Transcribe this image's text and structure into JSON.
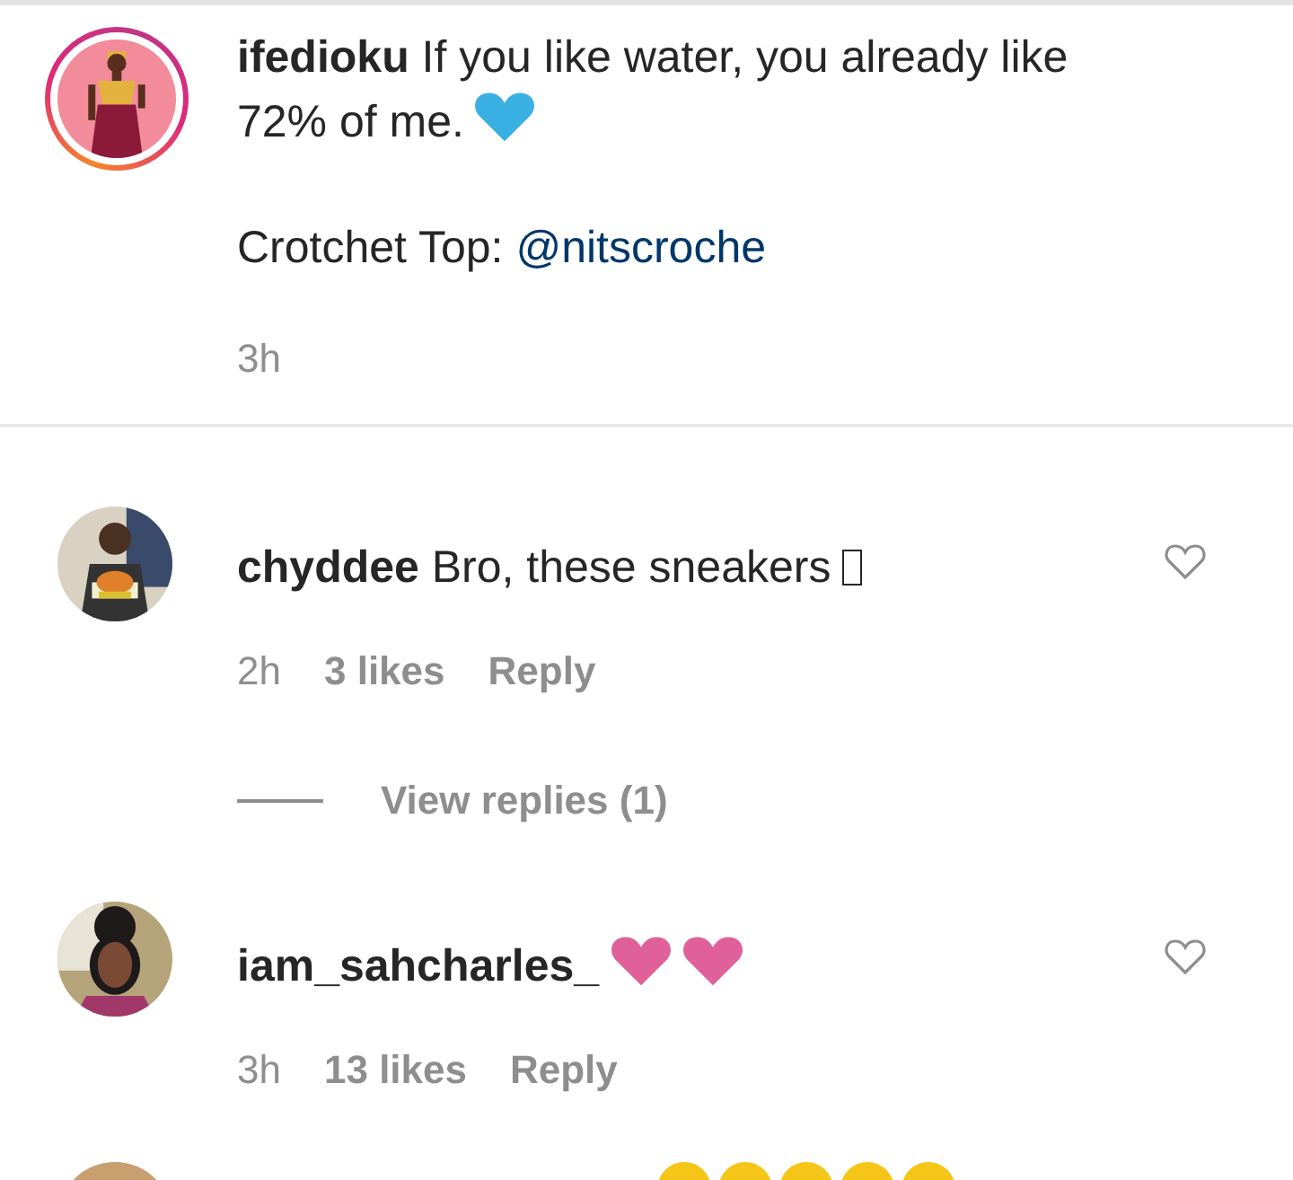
{
  "caption": {
    "username": "ifedioku",
    "text": "If you like water, you already like 72% of me.",
    "emoji": [
      {
        "kind": "heart",
        "color": "#3ab0e2"
      }
    ],
    "credit": "Crotchet Top:",
    "mention": "@nitscroche",
    "time": "3h"
  },
  "comments": [
    {
      "username": "chyddee",
      "text": "Bro, these sneakers",
      "emoji": [
        {
          "kind": "missing"
        }
      ],
      "time": "2h",
      "likes": "3 likes",
      "reply": "Reply",
      "liked": false,
      "view_replies": "View replies (1)"
    },
    {
      "username": "iam_sahcharles_",
      "emoji": [
        {
          "kind": "heart",
          "color": "#e0609a"
        },
        {
          "kind": "heart",
          "color": "#e0609a"
        }
      ],
      "time": "3h",
      "likes": "13 likes",
      "reply": "Reply",
      "liked": false
    }
  ]
}
